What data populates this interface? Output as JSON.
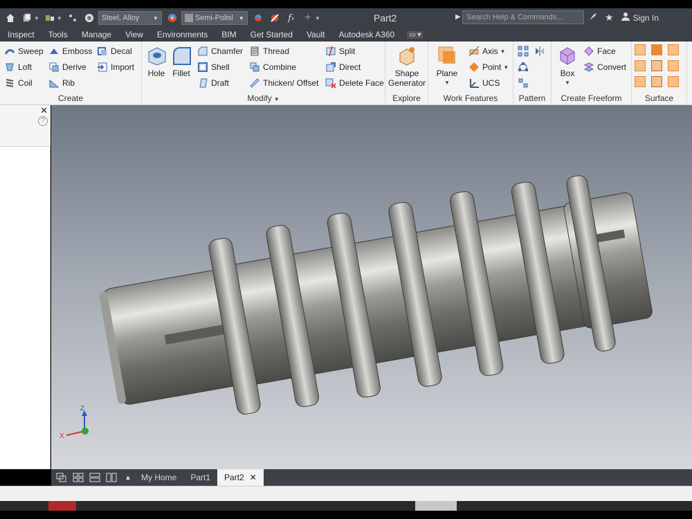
{
  "titlebar": {
    "material": "Steel, Alloy",
    "appearance": "Semi-Polisl",
    "document_title": "Part2",
    "search_placeholder": "Search Help & Commands...",
    "sign_in": "Sign In"
  },
  "menu": [
    "Inspect",
    "Tools",
    "Manage",
    "View",
    "Environments",
    "BIM",
    "Get Started",
    "Vault",
    "Autodesk A360"
  ],
  "ribbon": {
    "create": {
      "label": "Create",
      "sweep": "Sweep",
      "emboss": "Emboss",
      "decal": "Decal",
      "loft": "Loft",
      "derive": "Derive",
      "import": "Import",
      "coil": "Coil",
      "rib": "Rib"
    },
    "modify": {
      "label": "Modify",
      "hole": "Hole",
      "fillet": "Fillet",
      "chamfer": "Chamfer",
      "thread": "Thread",
      "split": "Split",
      "shell": "Shell",
      "combine": "Combine",
      "direct": "Direct",
      "draft": "Draft",
      "thicken": "Thicken/ Offset",
      "delete_face": "Delete Face"
    },
    "explore": {
      "label": "Explore",
      "shape_generator_1": "Shape",
      "shape_generator_2": "Generator"
    },
    "work": {
      "label": "Work Features",
      "plane": "Plane",
      "axis": "Axis",
      "point": "Point",
      "ucs": "UCS"
    },
    "pattern": {
      "label": "Pattern"
    },
    "freeform": {
      "label": "Create Freeform",
      "box": "Box",
      "face": "Face",
      "convert": "Convert"
    },
    "surface": {
      "label": "Surface"
    }
  },
  "triad": {
    "z": "Z",
    "x": "X"
  },
  "tabs": [
    "My Home",
    "Part1",
    "Part2"
  ],
  "colors": {
    "title_bg": "#3b3f46",
    "ribbon_bg": "#f3f3f3",
    "accent_orange": "#e8892f",
    "accent_blue": "#3a6fb0"
  }
}
